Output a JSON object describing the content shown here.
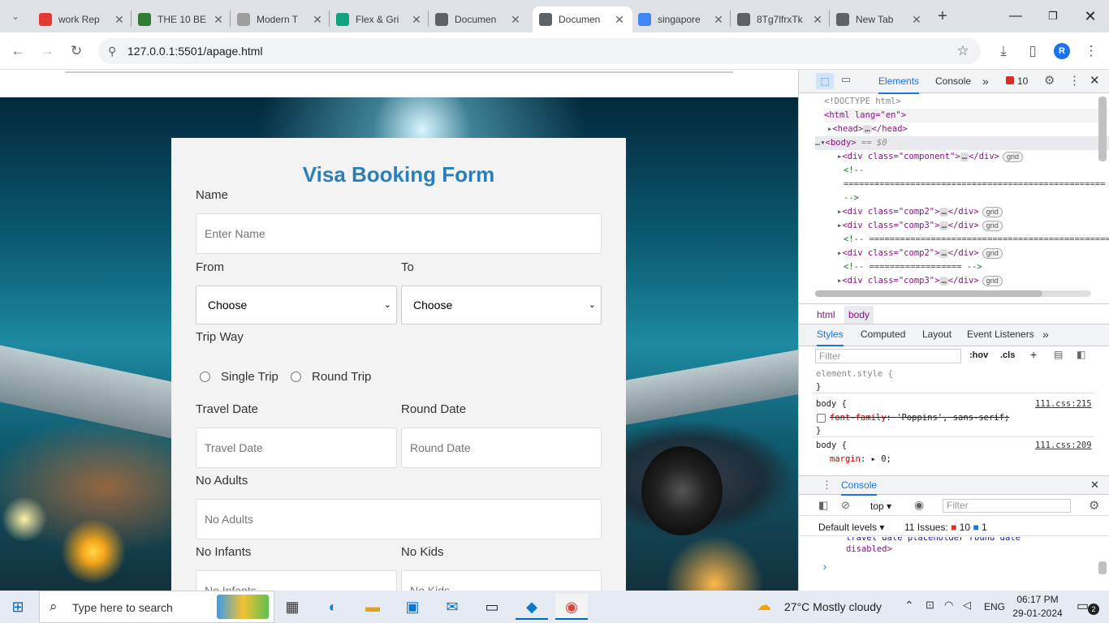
{
  "browser": {
    "tabs": [
      {
        "title": "work Rep",
        "icon": "workspace-icon",
        "color": "#e53935"
      },
      {
        "title": "THE 10 BE",
        "icon": "tripadvisor-icon",
        "color": "#2e7d32"
      },
      {
        "title": "Modern T",
        "icon": "page-icon",
        "color": "#9e9e9e"
      },
      {
        "title": "Flex & Gri",
        "icon": "openai-icon",
        "color": "#10a37f"
      },
      {
        "title": "Documen",
        "icon": "globe-icon",
        "color": "#5f6368"
      },
      {
        "title": "Documen",
        "icon": "globe-icon",
        "color": "#5f6368"
      },
      {
        "title": "singapore",
        "icon": "google-icon",
        "color": "#4285f4"
      },
      {
        "title": "8Tg7lfrxTk",
        "icon": "globe-icon",
        "color": "#5f6368"
      },
      {
        "title": "New Tab",
        "icon": "globe-icon",
        "color": "#5f6368"
      }
    ],
    "active_tab_index": 5,
    "url": "127.0.0.1:5501/apage.html",
    "profile_initial": "R"
  },
  "form": {
    "title": "Visa Booking Form",
    "name_label": "Name",
    "name_placeholder": "Enter Name",
    "from_label": "From",
    "to_label": "To",
    "from_value": "Choose",
    "to_value": "Choose",
    "trip_label": "Trip Way",
    "single_trip": "Single Trip",
    "round_trip": "Round Trip",
    "travel_date_label": "Travel Date",
    "round_date_label": "Round Date",
    "travel_date_placeholder": "Travel Date",
    "round_date_placeholder": "Round Date",
    "adults_label": "No Adults",
    "adults_placeholder": "No Adults",
    "infants_label": "No Infants",
    "kids_label": "No Kids",
    "infants_placeholder": "No Infants",
    "kids_placeholder": "No Kids"
  },
  "devtools": {
    "tabs": [
      "Elements",
      "Console"
    ],
    "error_count": "10",
    "dom_lines": [
      "<!DOCTYPE html>",
      "<html lang=\"en\">",
      "<head>",
      "</head>",
      "<body>",
      "== $0",
      "<div class=\"component\">",
      "</div>",
      "<!--",
      "===================================================",
      "-->",
      "<div class=\"comp2\">",
      "<div class=\"comp3\">",
      "<!-- ================================================",
      "<!-- ================== -->",
      "grid"
    ],
    "breadcrumb": [
      "html",
      "body"
    ],
    "style_tabs": [
      "Styles",
      "Computed",
      "Layout",
      "Event Listeners"
    ],
    "filter_placeholder": "Filter",
    "hov": ":hov",
    "cls": ".cls",
    "element_style": "element.style {",
    "rule1_selector": "body {",
    "rule1_source": "111.css:215",
    "rule1_prop": "font-family",
    "rule1_value": "'Poppins', sans-serif;",
    "rule2_selector": "body {",
    "rule2_source": "111.css:209",
    "rule2_prop": "margin",
    "rule2_value": "0;",
    "close_brace": "}",
    "console_title": "Console",
    "context": "top",
    "default_levels": "Default levels",
    "issues_label": "11 Issues:",
    "issues_errors": "10",
    "issues_info": "1",
    "console_text_1": "travel date placeholder round date",
    "console_text_2": "disabled>",
    "prompt": "›"
  },
  "taskbar": {
    "search_placeholder": "Type here to search",
    "weather": "27°C  Mostly cloudy",
    "language": "ENG",
    "time": "06:17 PM",
    "date": "29-01-2024",
    "notification_count": "2"
  }
}
